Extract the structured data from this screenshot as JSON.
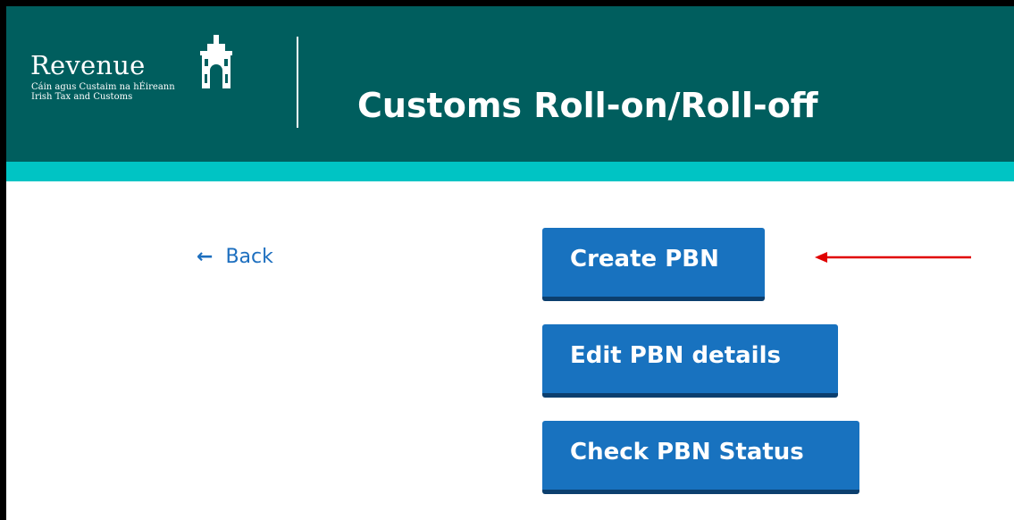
{
  "header": {
    "logo": {
      "name": "Revenue",
      "subtitle_irish": "Cáin agus Custaim na hÉireann",
      "subtitle_english": "Irish Tax and Customs",
      "icon": "castle-gate-icon"
    },
    "title": "Customs Roll-on/Roll-off",
    "colors": {
      "header_bg": "#005e5e",
      "accent_bar": "#00c4c4"
    }
  },
  "navigation": {
    "back_label": "Back",
    "back_icon": "arrow-left-icon"
  },
  "actions": {
    "create_label": "Create PBN",
    "edit_label": "Edit PBN details",
    "check_label": "Check PBN Status",
    "button_color": "#1872bf"
  },
  "annotation": {
    "type": "arrow",
    "color": "#e00000",
    "points_to": "create-pbn-button"
  }
}
